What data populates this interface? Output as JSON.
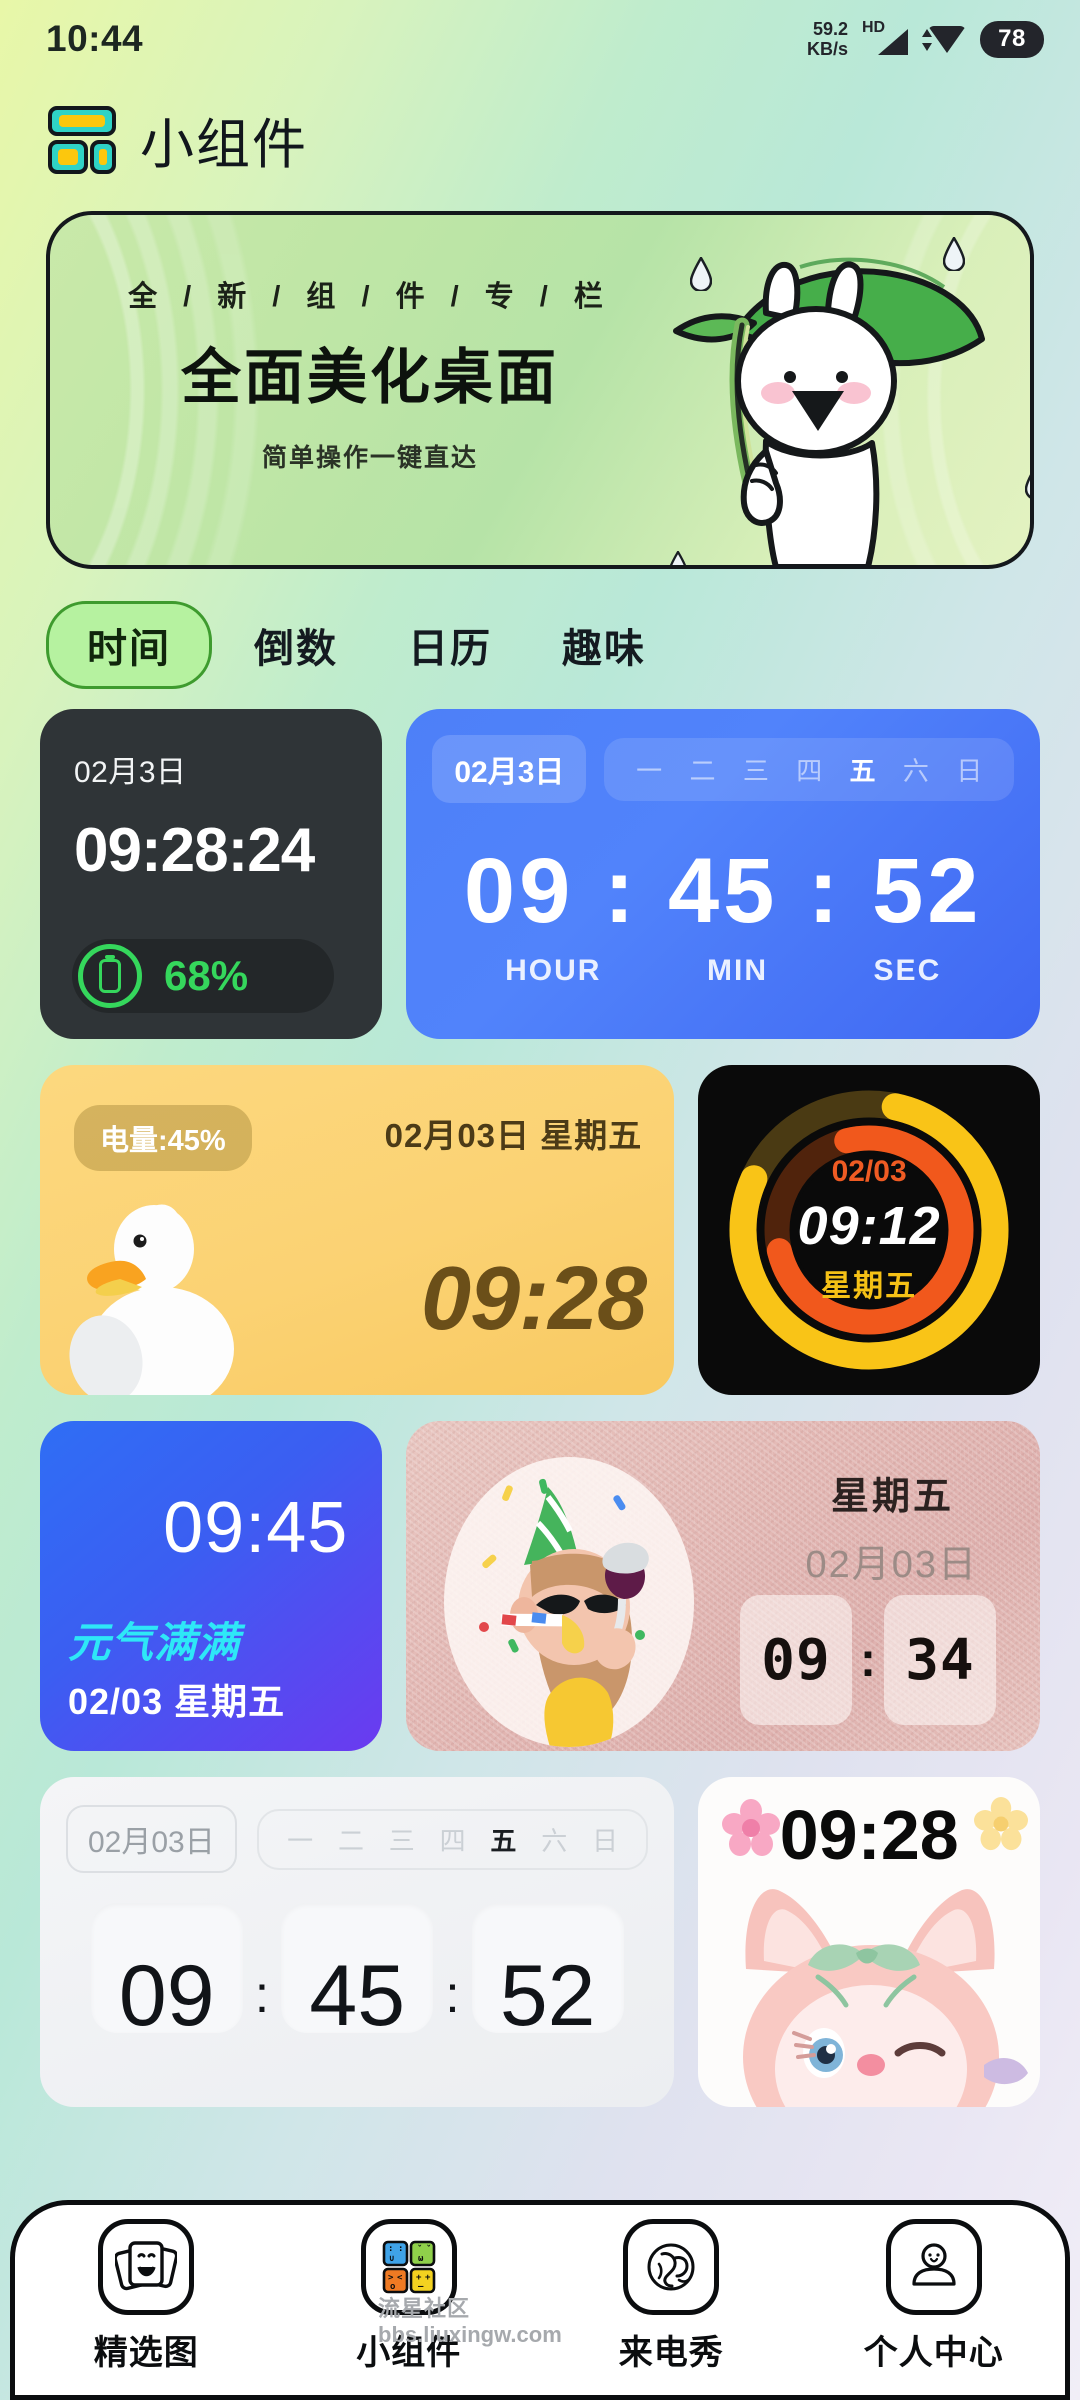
{
  "status_bar": {
    "time": "10:44",
    "net_speed_value": "59.2",
    "net_speed_unit": "KB/s",
    "hd_label": "HD",
    "battery": "78"
  },
  "header": {
    "title": "小组件",
    "logo_icon": "widget-grid-icon"
  },
  "banner": {
    "kicker": "全 / 新 / 组 / 件 / 专 / 栏",
    "title": "全面美化桌面",
    "subtitle": "简单操作一键直达",
    "illustration": "rabbit-with-leaf-umbrella"
  },
  "tabs": [
    {
      "label": "时间",
      "active": true
    },
    {
      "label": "倒数",
      "active": false
    },
    {
      "label": "日历",
      "active": false
    },
    {
      "label": "趣味",
      "active": false
    }
  ],
  "widgets": {
    "dark_clock": {
      "date": "02月3日",
      "time": "09:28:24",
      "battery_percent": "68%",
      "battery_icon": "battery-icon"
    },
    "blue_clock": {
      "date": "02月3日",
      "weekdays": [
        "一",
        "二",
        "三",
        "四",
        "五",
        "六",
        "日"
      ],
      "active_weekday": "五",
      "hour": "09",
      "minute": "45",
      "second": "52",
      "sep": ":",
      "label_hour": "HOUR",
      "label_min": "MIN",
      "label_sec": "SEC"
    },
    "duck_clock": {
      "battery_label": "电量:45%",
      "date": "02月03日 星期五",
      "time": "09:28",
      "illustration": "white-duck"
    },
    "ring_clock": {
      "date": "02/03",
      "time": "09:12",
      "weekday": "星期五"
    },
    "gradient_clock": {
      "time": "09:45",
      "tagline": "元气满满",
      "date": "02/03 星期五"
    },
    "pink_clock": {
      "weekday": "星期五",
      "date": "02月03日",
      "hour": "09",
      "minute": "34",
      "sep": ":",
      "illustration": "party-girl-with-wine"
    },
    "flip_clock": {
      "date": "02月03日",
      "weekdays": [
        "一",
        "二",
        "三",
        "四",
        "五",
        "六",
        "日"
      ],
      "active_weekday": "五",
      "hour": "09",
      "minute": "45",
      "second": "52",
      "sep": ":"
    },
    "fox_clock": {
      "time": "09:28",
      "illustration": "pink-fox-with-bow"
    }
  },
  "bottom_nav": [
    {
      "label": "精选图",
      "icon": "photo-cards-icon"
    },
    {
      "label": "小组件",
      "icon": "widget-grid-color-icon"
    },
    {
      "label": "来电秀",
      "icon": "call-show-icon"
    },
    {
      "label": "个人中心",
      "icon": "user-icon"
    }
  ],
  "watermark": {
    "line1": "流星社区",
    "line2": "bbs.liuxingw.com"
  },
  "colors": {
    "accent_green": "#b6f2a0",
    "accent_green_border": "#3e9b2e",
    "battery_green": "#35d75c",
    "blue_card": "#4d80f8",
    "yellow_card": "#fcd87f",
    "ring_yellow": "#f5c116",
    "ring_orange": "#ef5b23"
  }
}
